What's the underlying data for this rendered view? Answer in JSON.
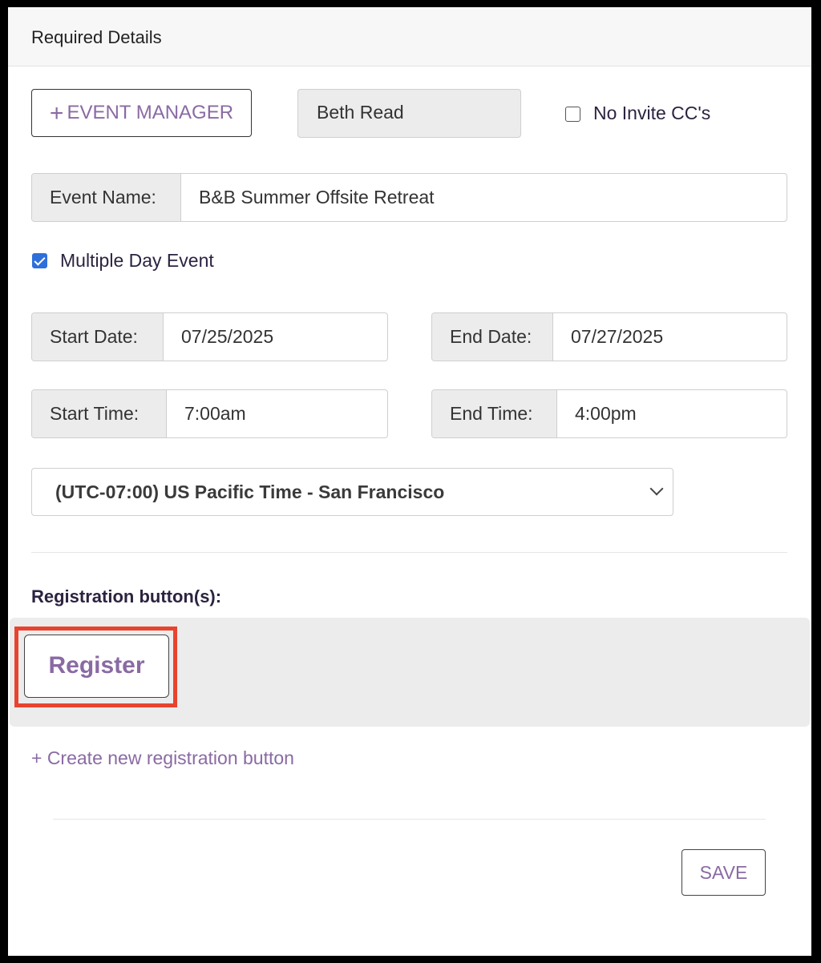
{
  "panel": {
    "title": "Required Details"
  },
  "manager": {
    "add_button_icon": "plus-icon",
    "add_button_symbol": "+",
    "add_button_label": "EVENT MANAGER",
    "current_manager": "Beth Read"
  },
  "no_invite_cc": {
    "label": "No Invite CC's",
    "checked": false
  },
  "event_name": {
    "label": "Event Name:",
    "value": "B&B Summer Offsite Retreat"
  },
  "multiple_day": {
    "label": "Multiple Day Event",
    "checked": true
  },
  "start_date": {
    "label": "Start Date:",
    "value": "07/25/2025"
  },
  "end_date": {
    "label": "End Date:",
    "value": "07/27/2025"
  },
  "start_time": {
    "label": "Start Time:",
    "value": "7:00am"
  },
  "end_time": {
    "label": "End Time:",
    "value": "4:00pm"
  },
  "timezone": {
    "selected": "(UTC-07:00) US Pacific Time - San Francisco",
    "icon": "chevron-down-icon"
  },
  "registration": {
    "heading": "Registration button(s):",
    "buttons": [
      {
        "label": "Register"
      }
    ],
    "create_link": "+ Create new registration button"
  },
  "footer": {
    "save_label": "SAVE"
  },
  "colors": {
    "accent_purple": "#8a6aa3",
    "checkbox_blue": "#2f6fdc",
    "highlight_red": "#e8432e",
    "addon_gray": "#ececec"
  }
}
